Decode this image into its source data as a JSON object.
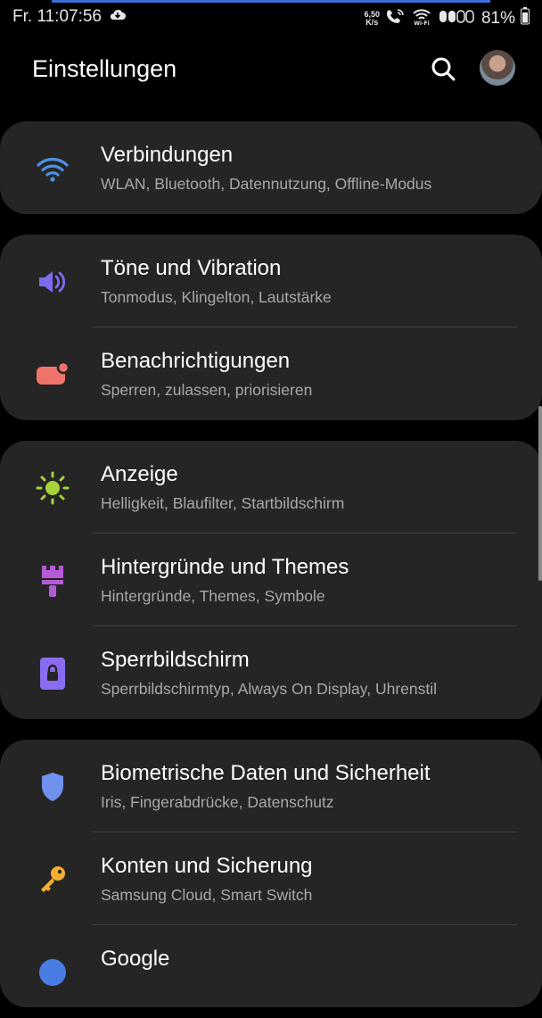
{
  "status": {
    "time": "Fr. 11:07:56",
    "net_speed_value": "6,50",
    "net_speed_unit": "K/s",
    "battery": "81%"
  },
  "header": {
    "title": "Einstellungen"
  },
  "groups": [
    {
      "items": [
        {
          "title": "Verbindungen",
          "subtitle": "WLAN, Bluetooth, Datennutzung, Offline-Modus",
          "icon": "wifi-icon",
          "color": "#4a90e2"
        }
      ]
    },
    {
      "items": [
        {
          "title": "Töne und Vibration",
          "subtitle": "Tonmodus, Klingelton, Lautstärke",
          "icon": "speaker-icon",
          "color": "#7b6cf0"
        },
        {
          "title": "Benachrichtigungen",
          "subtitle": "Sperren, zulassen, priorisieren",
          "icon": "notification-icon",
          "color": "#f0736a"
        }
      ]
    },
    {
      "items": [
        {
          "title": "Anzeige",
          "subtitle": "Helligkeit, Blaufilter, Startbildschirm",
          "icon": "sun-icon",
          "color": "#a6d23a"
        },
        {
          "title": "Hintergründe und Themes",
          "subtitle": "Hintergründe, Themes, Symbole",
          "icon": "paintbrush-icon",
          "color": "#b55ad6"
        },
        {
          "title": "Sperrbildschirm",
          "subtitle": "Sperrbildschirmtyp, Always On Display, Uhrenstil",
          "icon": "lock-icon",
          "color": "#8a6cf0"
        }
      ]
    },
    {
      "items": [
        {
          "title": "Biometrische Daten und Sicherheit",
          "subtitle": "Iris, Fingerabdrücke, Datenschutz",
          "icon": "shield-icon",
          "color": "#6f92ee"
        },
        {
          "title": "Konten und Sicherung",
          "subtitle": "Samsung Cloud, Smart Switch",
          "icon": "key-icon",
          "color": "#f5b031"
        },
        {
          "title": "Google",
          "subtitle": "",
          "icon": "google-icon",
          "color": "#4a7de2"
        }
      ]
    }
  ]
}
